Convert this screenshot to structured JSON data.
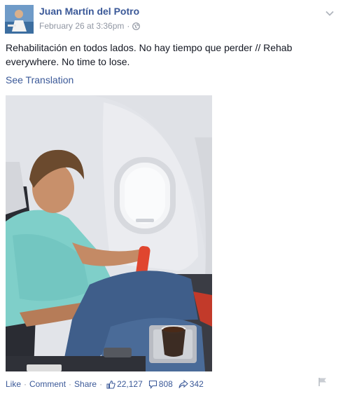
{
  "post": {
    "author": "Juan Martín del Potro",
    "timestamp": "February 26 at 3:36pm",
    "separator": "·",
    "audience_icon": "globe-icon",
    "options_icon": "chevron-down-icon",
    "text": "Rehabilitación en todos lados. No hay tiempo que perder // Rehab everywhere. No time to lose.",
    "see_translation": "See Translation",
    "photo_description_icon": "photo",
    "colors": {
      "link": "#3b5998",
      "text": "#141823",
      "meta": "#9197a3"
    }
  },
  "footer": {
    "like": "Like",
    "comment": "Comment",
    "share": "Share",
    "sep": "·",
    "likes_count": "22,127",
    "comments_count": "808",
    "shares_count": "342",
    "likes_icon": "thumbs-up-icon",
    "comments_icon": "comment-bubble-icon",
    "shares_icon": "share-arrow-icon",
    "report_icon": "flag-icon"
  }
}
